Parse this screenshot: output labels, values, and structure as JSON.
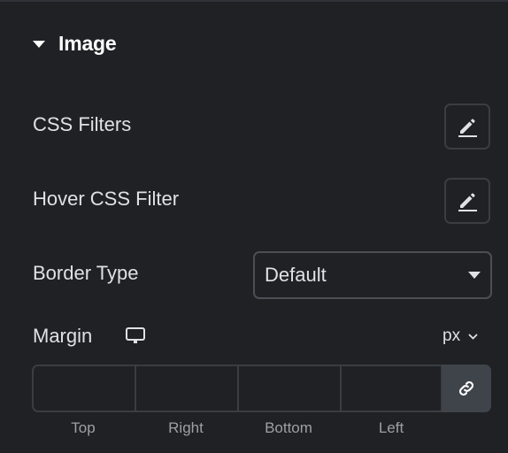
{
  "section": {
    "title": "Image",
    "expanded": true
  },
  "controls": {
    "css_filters": {
      "label": "CSS Filters",
      "button_icon": "pencil-edit-icon"
    },
    "hover_css_filter": {
      "label": "Hover CSS Filter",
      "button_icon": "pencil-edit-icon"
    },
    "border_type": {
      "label": "Border Type",
      "selected": "Default"
    },
    "margin": {
      "label": "Margin",
      "device_icon": "desktop-icon",
      "unit": "px",
      "fields": [
        {
          "label": "Top",
          "value": ""
        },
        {
          "label": "Right",
          "value": ""
        },
        {
          "label": "Bottom",
          "value": ""
        },
        {
          "label": "Left",
          "value": ""
        }
      ],
      "link_icon": "link-icon"
    }
  },
  "colors": {
    "background": "#1f2124",
    "text": "#e0e1e3",
    "muted_text": "#9da0a5",
    "border": "#3a3d42",
    "link_button_bg": "#3f434a"
  }
}
